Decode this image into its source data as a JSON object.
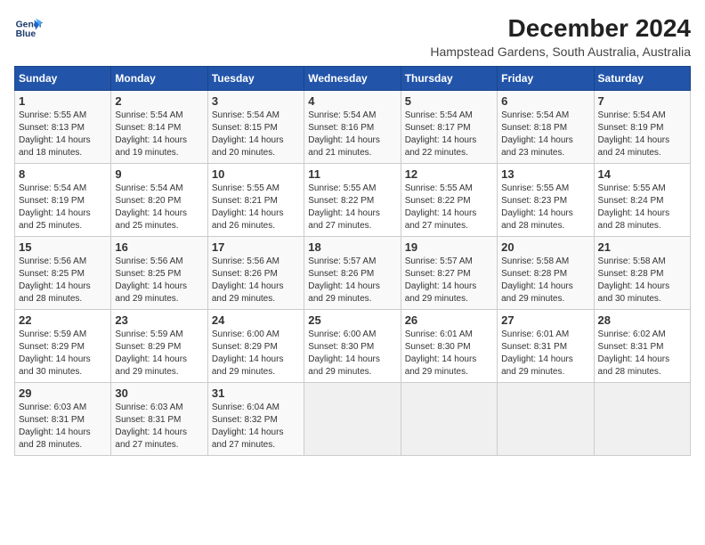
{
  "logo": {
    "line1": "General",
    "line2": "Blue"
  },
  "title": "December 2024",
  "subtitle": "Hampstead Gardens, South Australia, Australia",
  "days_of_week": [
    "Sunday",
    "Monday",
    "Tuesday",
    "Wednesday",
    "Thursday",
    "Friday",
    "Saturday"
  ],
  "weeks": [
    [
      {
        "day": "1",
        "info": "Sunrise: 5:55 AM\nSunset: 8:13 PM\nDaylight: 14 hours\nand 18 minutes."
      },
      {
        "day": "2",
        "info": "Sunrise: 5:54 AM\nSunset: 8:14 PM\nDaylight: 14 hours\nand 19 minutes."
      },
      {
        "day": "3",
        "info": "Sunrise: 5:54 AM\nSunset: 8:15 PM\nDaylight: 14 hours\nand 20 minutes."
      },
      {
        "day": "4",
        "info": "Sunrise: 5:54 AM\nSunset: 8:16 PM\nDaylight: 14 hours\nand 21 minutes."
      },
      {
        "day": "5",
        "info": "Sunrise: 5:54 AM\nSunset: 8:17 PM\nDaylight: 14 hours\nand 22 minutes."
      },
      {
        "day": "6",
        "info": "Sunrise: 5:54 AM\nSunset: 8:18 PM\nDaylight: 14 hours\nand 23 minutes."
      },
      {
        "day": "7",
        "info": "Sunrise: 5:54 AM\nSunset: 8:19 PM\nDaylight: 14 hours\nand 24 minutes."
      }
    ],
    [
      {
        "day": "8",
        "info": "Sunrise: 5:54 AM\nSunset: 8:19 PM\nDaylight: 14 hours\nand 25 minutes."
      },
      {
        "day": "9",
        "info": "Sunrise: 5:54 AM\nSunset: 8:20 PM\nDaylight: 14 hours\nand 25 minutes."
      },
      {
        "day": "10",
        "info": "Sunrise: 5:55 AM\nSunset: 8:21 PM\nDaylight: 14 hours\nand 26 minutes."
      },
      {
        "day": "11",
        "info": "Sunrise: 5:55 AM\nSunset: 8:22 PM\nDaylight: 14 hours\nand 27 minutes."
      },
      {
        "day": "12",
        "info": "Sunrise: 5:55 AM\nSunset: 8:22 PM\nDaylight: 14 hours\nand 27 minutes."
      },
      {
        "day": "13",
        "info": "Sunrise: 5:55 AM\nSunset: 8:23 PM\nDaylight: 14 hours\nand 28 minutes."
      },
      {
        "day": "14",
        "info": "Sunrise: 5:55 AM\nSunset: 8:24 PM\nDaylight: 14 hours\nand 28 minutes."
      }
    ],
    [
      {
        "day": "15",
        "info": "Sunrise: 5:56 AM\nSunset: 8:25 PM\nDaylight: 14 hours\nand 28 minutes."
      },
      {
        "day": "16",
        "info": "Sunrise: 5:56 AM\nSunset: 8:25 PM\nDaylight: 14 hours\nand 29 minutes."
      },
      {
        "day": "17",
        "info": "Sunrise: 5:56 AM\nSunset: 8:26 PM\nDaylight: 14 hours\nand 29 minutes."
      },
      {
        "day": "18",
        "info": "Sunrise: 5:57 AM\nSunset: 8:26 PM\nDaylight: 14 hours\nand 29 minutes."
      },
      {
        "day": "19",
        "info": "Sunrise: 5:57 AM\nSunset: 8:27 PM\nDaylight: 14 hours\nand 29 minutes."
      },
      {
        "day": "20",
        "info": "Sunrise: 5:58 AM\nSunset: 8:28 PM\nDaylight: 14 hours\nand 29 minutes."
      },
      {
        "day": "21",
        "info": "Sunrise: 5:58 AM\nSunset: 8:28 PM\nDaylight: 14 hours\nand 30 minutes."
      }
    ],
    [
      {
        "day": "22",
        "info": "Sunrise: 5:59 AM\nSunset: 8:29 PM\nDaylight: 14 hours\nand 30 minutes."
      },
      {
        "day": "23",
        "info": "Sunrise: 5:59 AM\nSunset: 8:29 PM\nDaylight: 14 hours\nand 29 minutes."
      },
      {
        "day": "24",
        "info": "Sunrise: 6:00 AM\nSunset: 8:29 PM\nDaylight: 14 hours\nand 29 minutes."
      },
      {
        "day": "25",
        "info": "Sunrise: 6:00 AM\nSunset: 8:30 PM\nDaylight: 14 hours\nand 29 minutes."
      },
      {
        "day": "26",
        "info": "Sunrise: 6:01 AM\nSunset: 8:30 PM\nDaylight: 14 hours\nand 29 minutes."
      },
      {
        "day": "27",
        "info": "Sunrise: 6:01 AM\nSunset: 8:31 PM\nDaylight: 14 hours\nand 29 minutes."
      },
      {
        "day": "28",
        "info": "Sunrise: 6:02 AM\nSunset: 8:31 PM\nDaylight: 14 hours\nand 28 minutes."
      }
    ],
    [
      {
        "day": "29",
        "info": "Sunrise: 6:03 AM\nSunset: 8:31 PM\nDaylight: 14 hours\nand 28 minutes."
      },
      {
        "day": "30",
        "info": "Sunrise: 6:03 AM\nSunset: 8:31 PM\nDaylight: 14 hours\nand 27 minutes."
      },
      {
        "day": "31",
        "info": "Sunrise: 6:04 AM\nSunset: 8:32 PM\nDaylight: 14 hours\nand 27 minutes."
      },
      null,
      null,
      null,
      null
    ]
  ]
}
